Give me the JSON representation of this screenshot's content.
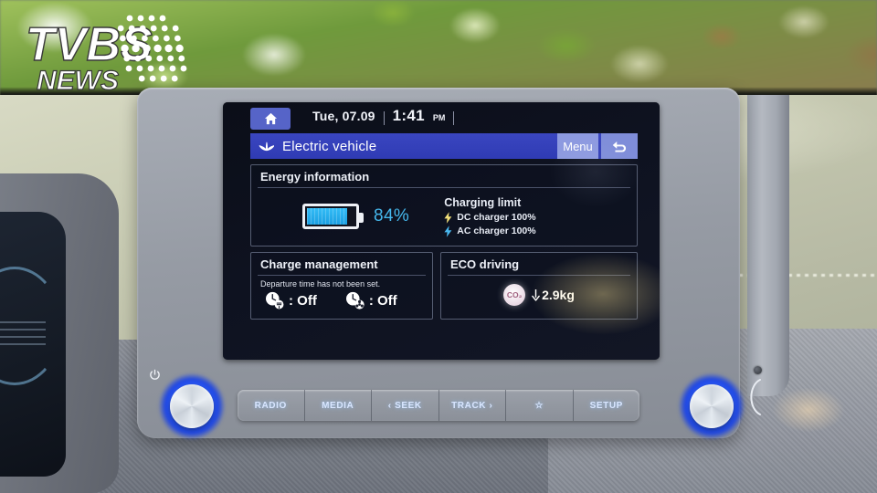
{
  "watermark": {
    "brand": "TVBS",
    "sub": "NEWS"
  },
  "statusbar": {
    "home_icon": "home-icon",
    "date": "Tue, 07.09",
    "time": "1:41",
    "ampm": "PM"
  },
  "titlebar": {
    "leaf_icon": "leaf-icon",
    "title": "Electric vehicle",
    "menu_label": "Menu",
    "back_icon": "back-arrow-icon"
  },
  "energy": {
    "title": "Energy information",
    "battery_icon": "battery-icon",
    "battery_percent_value": 84,
    "battery_percent": "84%",
    "charging_limit_title": "Charging limit",
    "dc_icon": "dc-bolt-icon",
    "dc_label": "DC charger 100%",
    "ac_icon": "ac-bolt-icon",
    "ac_label": "AC charger 100%"
  },
  "charge_management": {
    "title": "Charge management",
    "note": "Departure time has not been set.",
    "timer_charge_icon": "clock-plug-icon",
    "timer_charge_value": ": Off",
    "timer_climate_icon": "clock-climate-icon",
    "timer_climate_value": ": Off"
  },
  "eco": {
    "title": "ECO driving",
    "co2_icon": "co2-badge-icon",
    "co2_label": "CO₂",
    "arrow_icon": "arrow-down-icon",
    "value": "2.9kg"
  },
  "keybar": {
    "keys": [
      {
        "label": "RADIO",
        "icon": ""
      },
      {
        "label": "MEDIA",
        "icon": ""
      },
      {
        "label": "‹ SEEK",
        "icon": "seek-prev-icon"
      },
      {
        "label": "TRACK ›",
        "icon": "track-next-icon"
      },
      {
        "label": "☆",
        "icon": "star-icon"
      },
      {
        "label": "SETUP",
        "icon": ""
      }
    ]
  },
  "knobs": {
    "left_name": "power-volume-knob",
    "left_icon": "power-icon",
    "right_name": "tune-knob"
  },
  "colors": {
    "accent_blue": "#2f3bb4",
    "battery_cyan": "#2fb6f2",
    "percent_text": "#45b7ec",
    "knob_ring": "#2b5cff"
  }
}
